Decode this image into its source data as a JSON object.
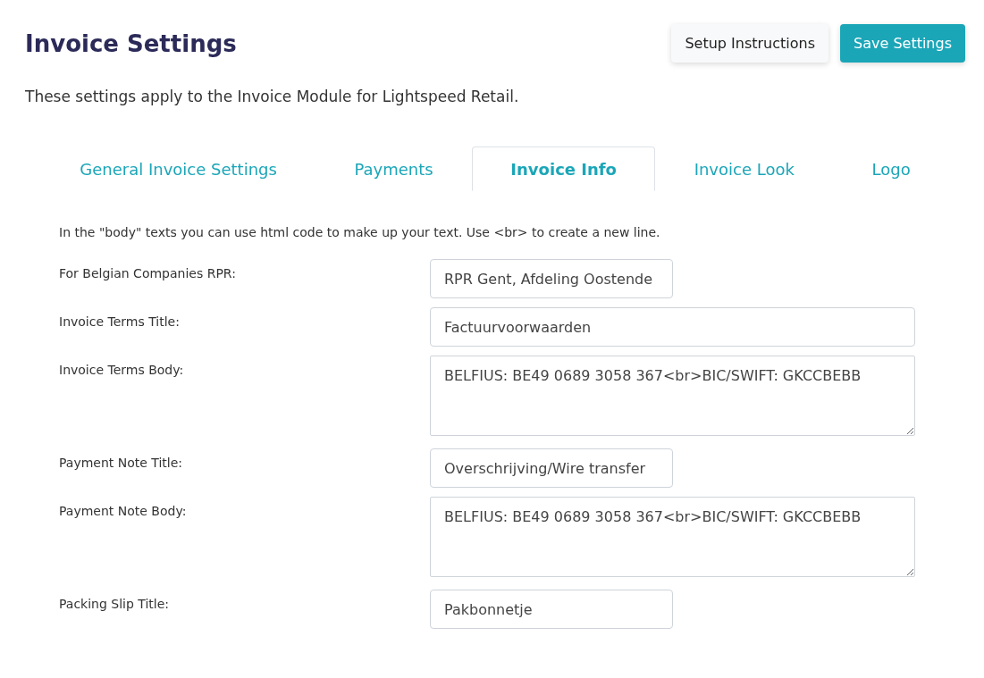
{
  "header": {
    "title": "Invoice Settings",
    "buttons": [
      {
        "label": "Setup Instructions",
        "kind": "secondary"
      },
      {
        "label": "Save Settings",
        "kind": "primary"
      }
    ]
  },
  "description": "These settings apply to the Invoice Module for Lightspeed Retail.",
  "tabs": [
    {
      "label": "General Invoice Settings",
      "selected": false
    },
    {
      "label": "Payments",
      "selected": false
    },
    {
      "label": "Invoice Info",
      "selected": true
    },
    {
      "label": "Invoice Look",
      "selected": false
    },
    {
      "label": "Logo",
      "selected": false
    }
  ],
  "hint": "In the \"body\" texts you can use html code to make up your text. Use <br> to create a new line.",
  "fields": [
    {
      "label": "For Belgian Companies RPR:",
      "value": "RPR Gent, Afdeling Oostende",
      "kind": "short"
    },
    {
      "label": "Invoice Terms Title:",
      "value": "Factuurvoorwaarden",
      "kind": "wide"
    },
    {
      "label": "Invoice Terms Body:",
      "value": "BELFIUS: BE49 0689 3058 367<br>BIC/SWIFT: GKCCBEBB",
      "kind": "textarea"
    },
    {
      "label": "Payment Note Title:",
      "value": "Overschrijving/Wire transfer",
      "kind": "short"
    },
    {
      "label": "Payment Note Body:",
      "value": "BELFIUS: BE49 0689 3058 367<br>BIC/SWIFT: GKCCBEBB",
      "kind": "textarea"
    },
    {
      "label": "Packing Slip Title:",
      "value": "Pakbonnetje",
      "kind": "short"
    }
  ]
}
